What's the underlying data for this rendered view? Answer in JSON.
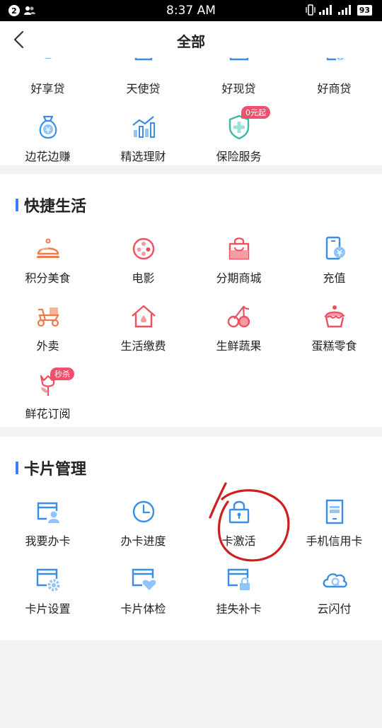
{
  "status": {
    "time": "8:37 AM",
    "notif_count": "2",
    "battery": "93"
  },
  "nav": {
    "title": "全部"
  },
  "finance": {
    "items": [
      {
        "label": "好享贷",
        "icon": "loan-icon"
      },
      {
        "label": "天使贷",
        "icon": "loan-icon"
      },
      {
        "label": "好现贷",
        "icon": "loan-icon"
      },
      {
        "label": "好商贷",
        "icon": "loan-icon"
      },
      {
        "label": "边花边赚",
        "icon": "money-bag-icon"
      },
      {
        "label": "精选理财",
        "icon": "chart-icon"
      },
      {
        "label": "保险服务",
        "icon": "shield-icon",
        "tag": "0元起"
      }
    ]
  },
  "life": {
    "title": "快捷生活",
    "items": [
      {
        "label": "积分美食",
        "icon": "dish-cover-icon"
      },
      {
        "label": "电影",
        "icon": "film-reel-icon"
      },
      {
        "label": "分期商城",
        "icon": "shopping-bag-icon"
      },
      {
        "label": "充值",
        "icon": "phone-recharge-icon"
      },
      {
        "label": "外卖",
        "icon": "scooter-icon"
      },
      {
        "label": "生活缴费",
        "icon": "house-icon"
      },
      {
        "label": "生鲜蔬果",
        "icon": "cherry-icon"
      },
      {
        "label": "蛋糕零食",
        "icon": "cake-icon"
      },
      {
        "label": "鲜花订阅",
        "icon": "tulip-icon",
        "tag": "秒杀"
      }
    ]
  },
  "card": {
    "title": "卡片管理",
    "items": [
      {
        "label": "我要办卡",
        "icon": "card-user-icon"
      },
      {
        "label": "办卡进度",
        "icon": "clock-icon"
      },
      {
        "label": "卡激活",
        "icon": "lock-icon"
      },
      {
        "label": "手机信用卡",
        "icon": "phone-card-icon"
      },
      {
        "label": "卡片设置",
        "icon": "card-gear-icon"
      },
      {
        "label": "卡片体检",
        "icon": "card-heart-icon"
      },
      {
        "label": "挂失补卡",
        "icon": "card-lock-icon"
      },
      {
        "label": "云闪付",
        "icon": "cloud-q-icon"
      }
    ]
  },
  "colors": {
    "blue": "#3a8ee6",
    "orange": "#f07a4a",
    "red": "#ef4f5f",
    "teal": "#3cb8a5",
    "accent": "#3d7bff",
    "annotation": "#cc1f1f"
  }
}
